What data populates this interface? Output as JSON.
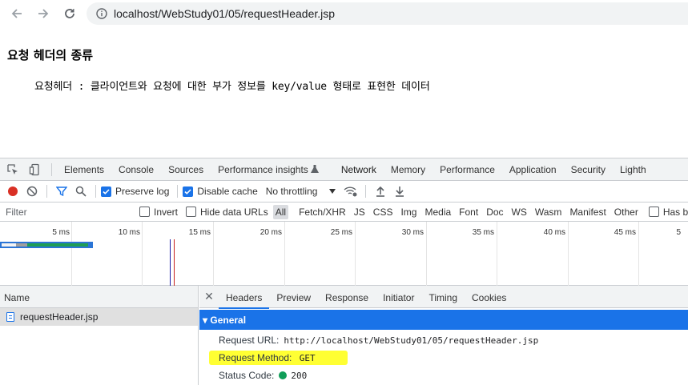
{
  "browser": {
    "url": "localhost/WebStudy01/05/requestHeader.jsp"
  },
  "page": {
    "title": "요청 헤더의 종류",
    "description": "요청헤더 : 클라이언트와 요청에 대한 부가 정보를 key/value 형태로 표현한 데이터"
  },
  "devtools": {
    "tabs": [
      {
        "label": "Elements"
      },
      {
        "label": "Console"
      },
      {
        "label": "Sources"
      },
      {
        "label": "Performance insights"
      },
      {
        "label": "Network"
      },
      {
        "label": "Memory"
      },
      {
        "label": "Performance"
      },
      {
        "label": "Application"
      },
      {
        "label": "Security"
      },
      {
        "label": "Lighth"
      }
    ],
    "active_tab": "Network",
    "toolbar": {
      "preserve_log": "Preserve log",
      "disable_cache": "Disable cache",
      "throttling": "No throttling"
    },
    "filter": {
      "placeholder": "Filter",
      "invert": "Invert",
      "hide_data_urls": "Hide data URLs",
      "types": [
        "All",
        "Fetch/XHR",
        "JS",
        "CSS",
        "Img",
        "Media",
        "Font",
        "Doc",
        "WS",
        "Wasm",
        "Manifest",
        "Other"
      ],
      "active_type": "All",
      "has_blocked": "Has blo"
    },
    "overview": {
      "ticks": [
        "5 ms",
        "10 ms",
        "15 ms",
        "20 ms",
        "25 ms",
        "30 ms",
        "35 ms",
        "40 ms",
        "45 ms",
        "5"
      ]
    },
    "request_list": {
      "header": "Name",
      "rows": [
        {
          "name": "requestHeader.jsp"
        }
      ]
    },
    "details": {
      "tabs": [
        "Headers",
        "Preview",
        "Response",
        "Initiator",
        "Timing",
        "Cookies"
      ],
      "active_tab": "Headers",
      "section": "▾ General",
      "request_url_label": "Request URL:",
      "request_url": "http://localhost/WebStudy01/05/requestHeader.jsp",
      "request_method_label": "Request Method:",
      "request_method": "GET",
      "status_code_label": "Status Code:",
      "status_code": "200"
    }
  }
}
